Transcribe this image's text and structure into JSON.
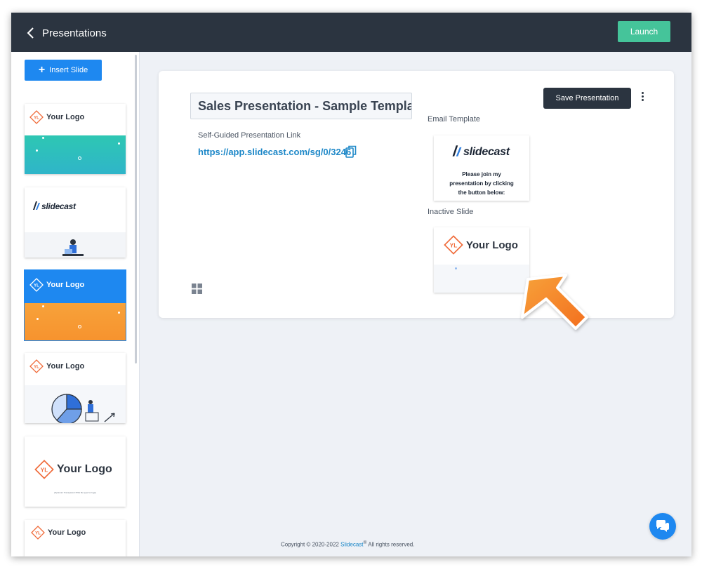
{
  "header": {
    "back_label": "Presentations",
    "launch_label": "Launch"
  },
  "sidebar": {
    "insert_label": "Insert Slide",
    "slides": [
      {
        "logo_text": "Your Logo",
        "selected": false
      },
      {
        "logo_text": "slidecast",
        "selected": false
      },
      {
        "logo_text": "Your Logo",
        "selected": true
      },
      {
        "logo_text": "Your Logo",
        "selected": false
      },
      {
        "logo_text": "Your Logo",
        "caption": "(Optional: Transparent PNG file type for logo)",
        "selected": false
      },
      {
        "logo_text": "Your Logo",
        "selected": false
      }
    ]
  },
  "presentation": {
    "title": "Sales Presentation - Sample Templa",
    "link_label": "Self-Guided Presentation Link",
    "link": "https://app.slidecast.com/sg/0/3246",
    "save_label": "Save Presentation",
    "email_template_label": "Email Template",
    "email_logo": "slidecast",
    "email_text": "Please join my presentation by clicking the button below:",
    "inactive_slide_label": "Inactive Slide",
    "inactive_logo_text": "Your Logo"
  },
  "footer": {
    "copyright_prefix": "Copyright © 2020-2022 ",
    "brand": "Slidecast",
    "reg": "®",
    "rights": " All rights reserved."
  },
  "colors": {
    "topbar": "#2b3440",
    "launch": "#45c49a",
    "primary": "#1e88f0",
    "link": "#1e88c8",
    "teal": "#2bbcb8",
    "orange": "#f7a23a",
    "logo_orange": "#f06b3a"
  },
  "icons": {
    "back": "chevron-left-icon",
    "copy": "copy-icon",
    "grid": "grid-icon",
    "more": "kebab-icon",
    "chat": "chat-icon"
  }
}
